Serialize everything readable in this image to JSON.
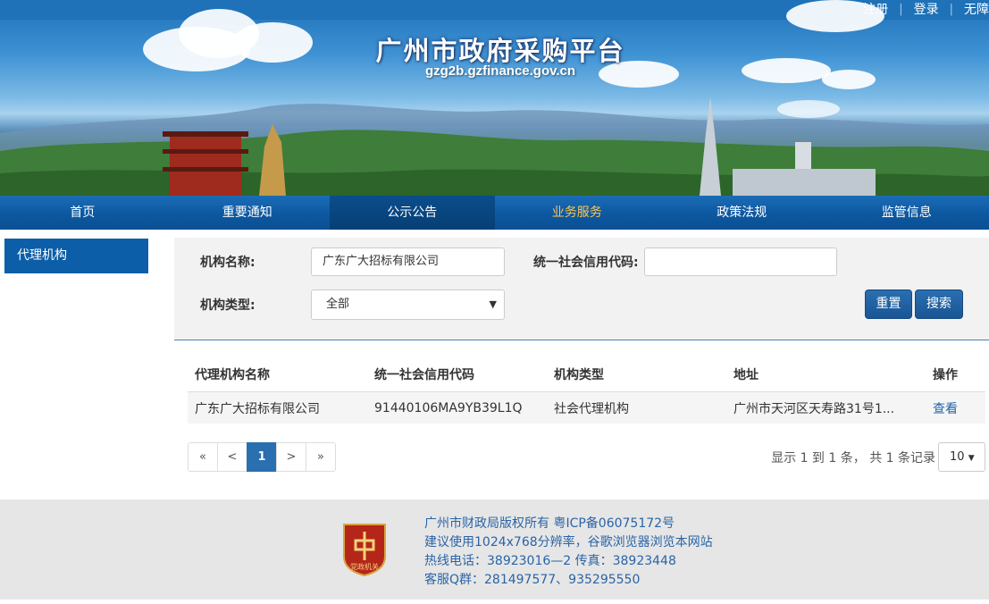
{
  "header": {
    "title": "广州市政府采购平台",
    "url": "gzg2b.gzfinance.gov.cn",
    "top_links": [
      "注册",
      "登录",
      "无障"
    ]
  },
  "nav": {
    "items": [
      "首页",
      "重要通知",
      "公示公告",
      "业务服务",
      "政策法规",
      "监管信息"
    ],
    "active_index": 2,
    "highlight_index": 3,
    "colors": {
      "bar": "#0d58a0",
      "active": "#073f75",
      "highlight_text": "#ffc64a"
    }
  },
  "sidebar": {
    "items": [
      "代理机构"
    ]
  },
  "search": {
    "name_label": "机构名称:",
    "name_value": "广东广大招标有限公司",
    "credit_label": "统一社会信用代码:",
    "credit_value": "",
    "type_label": "机构类型:",
    "type_selected": "全部",
    "reset_label": "重置",
    "search_label": "搜索"
  },
  "table": {
    "headers": [
      "代理机构名称",
      "统一社会信用代码",
      "机构类型",
      "地址",
      "操作"
    ],
    "rows": [
      {
        "name": "广东广大招标有限公司",
        "credit_code": "91440106MA9YB39L1Q",
        "type": "社会代理机构",
        "address": "广州市天河区天寿路31号1...",
        "action": "查看"
      }
    ]
  },
  "pagination": {
    "first": "«",
    "prev": "<",
    "current": "1",
    "next": ">",
    "last": "»",
    "info": "显示 1 到 1 条，  共 1 条记录",
    "page_size": "10"
  },
  "footer": {
    "emblem_text": "党政机关",
    "lines": [
      "广州市财政局版权所有     粤ICP备06075172号",
      "建议使用1024x768分辨率，谷歌浏览器浏览本网站",
      "热线电话：38923016—2     传真：38923448",
      "客服Q群：281497577、935295550"
    ]
  }
}
